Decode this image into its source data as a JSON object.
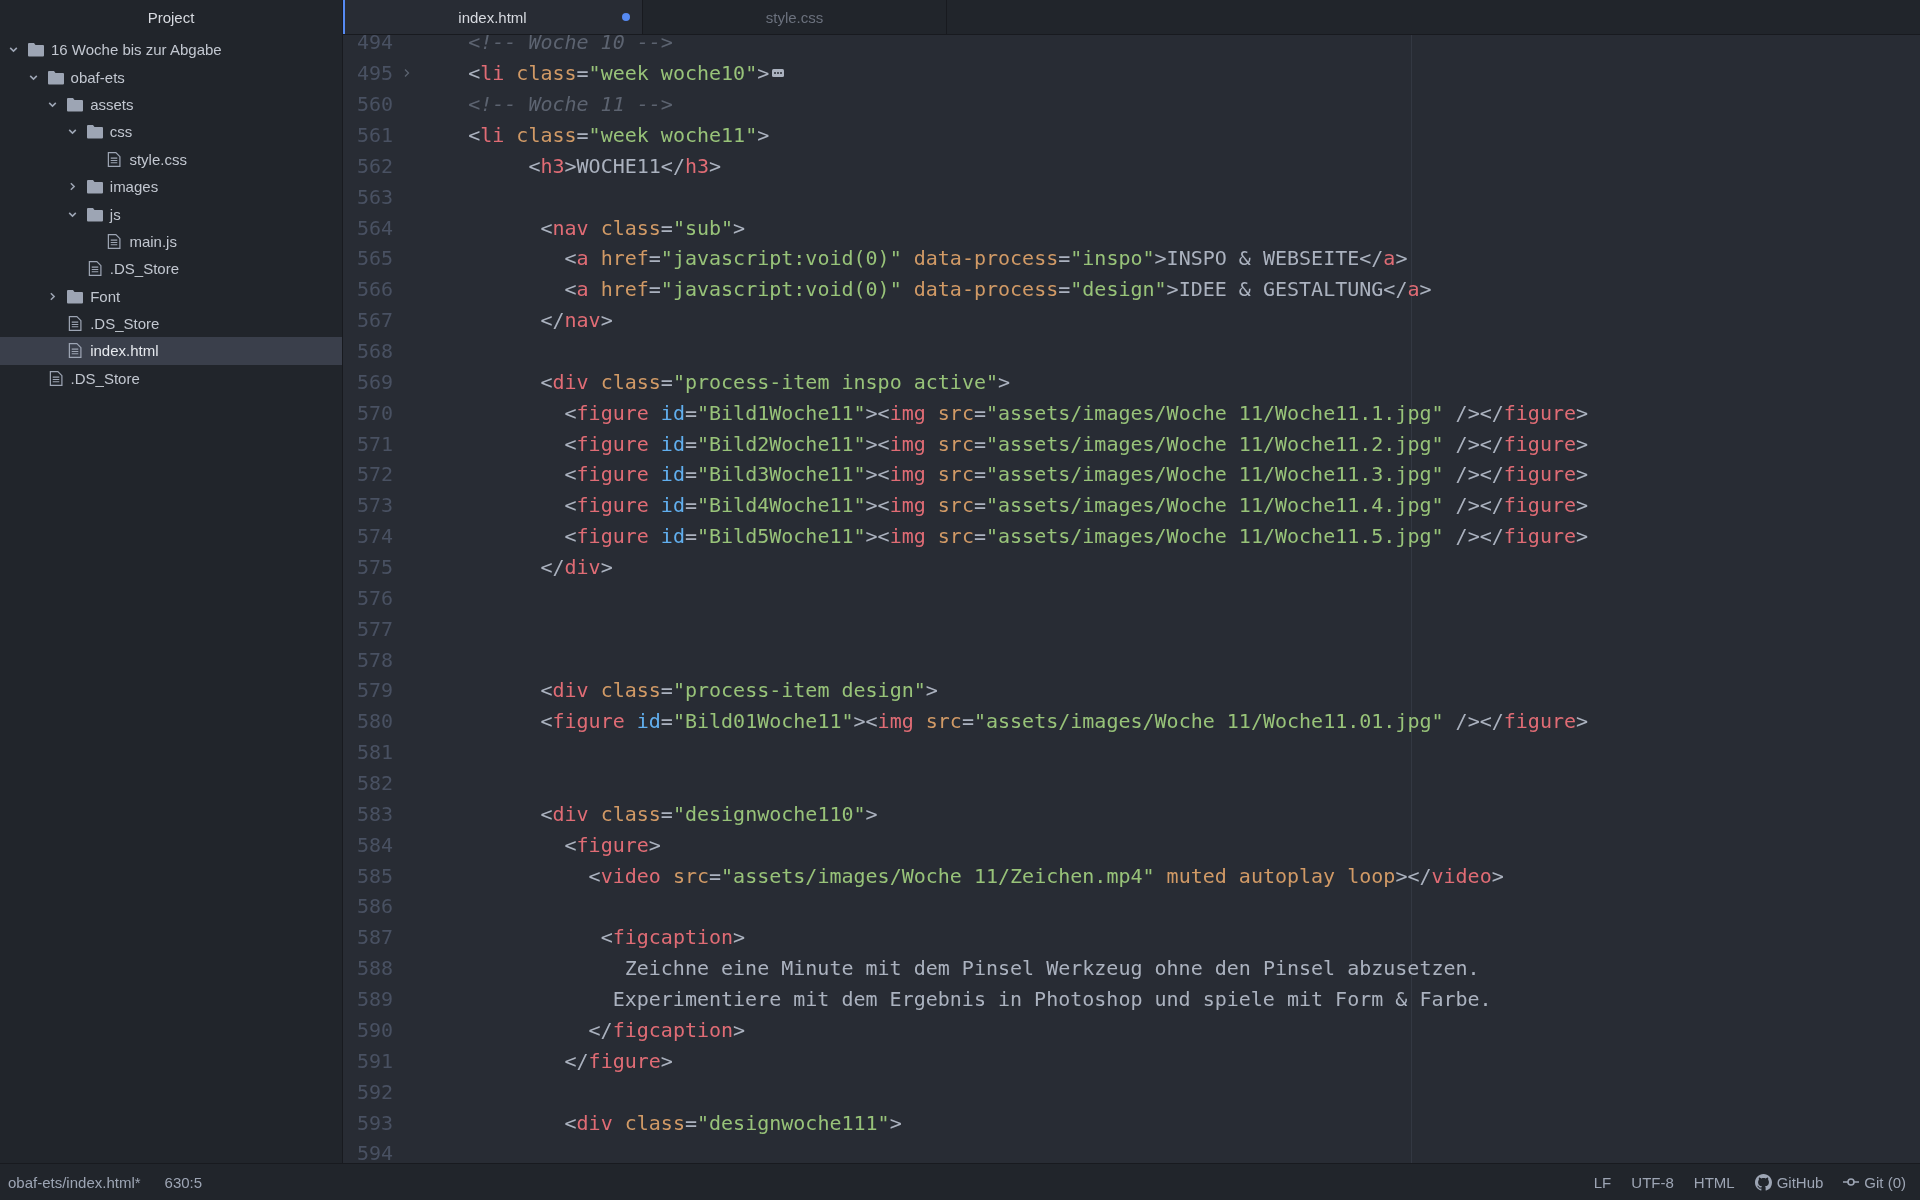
{
  "sidebar": {
    "title": "Project",
    "tree": [
      {
        "kind": "folder",
        "name": "16 Woche bis zur Abgabe",
        "expanded": true,
        "selected": false,
        "children": [
          {
            "kind": "folder",
            "name": "obaf-ets",
            "expanded": true,
            "selected": false,
            "children": [
              {
                "kind": "folder",
                "name": "assets",
                "expanded": true,
                "selected": false,
                "children": [
                  {
                    "kind": "folder",
                    "name": "css",
                    "expanded": true,
                    "selected": false,
                    "children": [
                      {
                        "kind": "file",
                        "name": "style.css",
                        "selected": false
                      }
                    ]
                  },
                  {
                    "kind": "folder",
                    "name": "images",
                    "expanded": false,
                    "selected": false
                  },
                  {
                    "kind": "folder",
                    "name": "js",
                    "expanded": true,
                    "selected": false,
                    "children": [
                      {
                        "kind": "file",
                        "name": "main.js",
                        "selected": false
                      }
                    ]
                  },
                  {
                    "kind": "file",
                    "name": ".DS_Store",
                    "selected": false
                  }
                ]
              },
              {
                "kind": "folder",
                "name": "Font",
                "expanded": false,
                "selected": false
              },
              {
                "kind": "file",
                "name": ".DS_Store",
                "selected": false
              },
              {
                "kind": "file",
                "name": "index.html",
                "selected": true
              }
            ]
          },
          {
            "kind": "file",
            "name": ".DS_Store",
            "selected": false
          }
        ]
      }
    ]
  },
  "tabs": [
    {
      "label": "index.html",
      "selected": true,
      "modified": true
    },
    {
      "label": "style.css",
      "selected": false,
      "modified": false
    }
  ],
  "editor": {
    "lines": [
      {
        "no": "494",
        "folded": false,
        "code": [
          {
            "kind": "com",
            "text": "    <!-- Woche 10 -->"
          }
        ]
      },
      {
        "no": "495",
        "folded": true,
        "code": [
          {
            "kind": "p",
            "text": "    <"
          },
          {
            "kind": "tag",
            "text": "li"
          },
          {
            "kind": "attr",
            "text": " class"
          },
          {
            "kind": "p",
            "text": "="
          },
          {
            "kind": "str",
            "text": "\"week woche10\""
          },
          {
            "kind": "p",
            "text": ">"
          }
        ]
      },
      {
        "no": "560",
        "folded": false,
        "code": [
          {
            "kind": "com",
            "text": "    <!-- Woche 11 -->"
          }
        ]
      },
      {
        "no": "561",
        "folded": false,
        "code": [
          {
            "kind": "p",
            "text": "    <"
          },
          {
            "kind": "tag",
            "text": "li"
          },
          {
            "kind": "attr",
            "text": " class"
          },
          {
            "kind": "p",
            "text": "="
          },
          {
            "kind": "str",
            "text": "\"week woche11\""
          },
          {
            "kind": "p",
            "text": ">"
          }
        ]
      },
      {
        "no": "562",
        "folded": false,
        "code": [
          {
            "kind": "p",
            "text": "         <"
          },
          {
            "kind": "tag",
            "text": "h3"
          },
          {
            "kind": "p",
            "text": ">WOCHE11</"
          },
          {
            "kind": "tag",
            "text": "h3"
          },
          {
            "kind": "p",
            "text": ">"
          }
        ]
      },
      {
        "no": "563",
        "folded": false
      },
      {
        "no": "564",
        "folded": false,
        "code": [
          {
            "kind": "p",
            "text": "          <"
          },
          {
            "kind": "tag",
            "text": "nav"
          },
          {
            "kind": "attr",
            "text": " class"
          },
          {
            "kind": "p",
            "text": "="
          },
          {
            "kind": "str",
            "text": "\"sub\""
          },
          {
            "kind": "p",
            "text": ">"
          }
        ]
      },
      {
        "no": "565",
        "folded": false,
        "code": [
          {
            "kind": "p",
            "text": "            <"
          },
          {
            "kind": "tag",
            "text": "a"
          },
          {
            "kind": "attr",
            "text": " href"
          },
          {
            "kind": "p",
            "text": "="
          },
          {
            "kind": "str",
            "text": "\"javascript:void(0)\""
          },
          {
            "kind": "attr",
            "text": " data-process"
          },
          {
            "kind": "p",
            "text": "="
          },
          {
            "kind": "str",
            "text": "\"inspo\""
          },
          {
            "kind": "p",
            "text": ">INSPO & WEBSEITE</"
          },
          {
            "kind": "tag",
            "text": "a"
          },
          {
            "kind": "p",
            "text": ">"
          }
        ]
      },
      {
        "no": "566",
        "folded": false,
        "code": [
          {
            "kind": "p",
            "text": "            <"
          },
          {
            "kind": "tag",
            "text": "a"
          },
          {
            "kind": "attr",
            "text": " href"
          },
          {
            "kind": "p",
            "text": "="
          },
          {
            "kind": "str",
            "text": "\"javascript:void(0)\""
          },
          {
            "kind": "attr",
            "text": " data-process"
          },
          {
            "kind": "p",
            "text": "="
          },
          {
            "kind": "str",
            "text": "\"design\""
          },
          {
            "kind": "p",
            "text": ">IDEE & GESTALTUNG</"
          },
          {
            "kind": "tag",
            "text": "a"
          },
          {
            "kind": "p",
            "text": ">"
          }
        ]
      },
      {
        "no": "567",
        "folded": false,
        "code": [
          {
            "kind": "p",
            "text": "          </"
          },
          {
            "kind": "tag",
            "text": "nav"
          },
          {
            "kind": "p",
            "text": ">"
          }
        ]
      },
      {
        "no": "568",
        "folded": false
      },
      {
        "no": "569",
        "folded": false,
        "code": [
          {
            "kind": "p",
            "text": "          <"
          },
          {
            "kind": "tag",
            "text": "div"
          },
          {
            "kind": "attr",
            "text": " class"
          },
          {
            "kind": "p",
            "text": "="
          },
          {
            "kind": "str",
            "text": "\"process-item inspo active\""
          },
          {
            "kind": "p",
            "text": ">"
          }
        ]
      },
      {
        "no": "570",
        "folded": false,
        "code": [
          {
            "kind": "p",
            "text": "            <"
          },
          {
            "kind": "tag",
            "text": "figure"
          },
          {
            "kind": "id",
            "text": " id"
          },
          {
            "kind": "p",
            "text": "="
          },
          {
            "kind": "str",
            "text": "\"Bild1Woche11\""
          },
          {
            "kind": "p",
            "text": "><"
          },
          {
            "kind": "tag",
            "text": "img"
          },
          {
            "kind": "attr",
            "text": " src"
          },
          {
            "kind": "p",
            "text": "="
          },
          {
            "kind": "str",
            "text": "\"assets/images/Woche 11/Woche11.1.jpg\""
          },
          {
            "kind": "p",
            "text": " /></"
          },
          {
            "kind": "tag",
            "text": "figure"
          },
          {
            "kind": "p",
            "text": ">"
          }
        ]
      },
      {
        "no": "571",
        "folded": false,
        "code": [
          {
            "kind": "p",
            "text": "            <"
          },
          {
            "kind": "tag",
            "text": "figure"
          },
          {
            "kind": "id",
            "text": " id"
          },
          {
            "kind": "p",
            "text": "="
          },
          {
            "kind": "str",
            "text": "\"Bild2Woche11\""
          },
          {
            "kind": "p",
            "text": "><"
          },
          {
            "kind": "tag",
            "text": "img"
          },
          {
            "kind": "attr",
            "text": " src"
          },
          {
            "kind": "p",
            "text": "="
          },
          {
            "kind": "str",
            "text": "\"assets/images/Woche 11/Woche11.2.jpg\""
          },
          {
            "kind": "p",
            "text": " /></"
          },
          {
            "kind": "tag",
            "text": "figure"
          },
          {
            "kind": "p",
            "text": ">"
          }
        ]
      },
      {
        "no": "572",
        "folded": false,
        "code": [
          {
            "kind": "p",
            "text": "            <"
          },
          {
            "kind": "tag",
            "text": "figure"
          },
          {
            "kind": "id",
            "text": " id"
          },
          {
            "kind": "p",
            "text": "="
          },
          {
            "kind": "str",
            "text": "\"Bild3Woche11\""
          },
          {
            "kind": "p",
            "text": "><"
          },
          {
            "kind": "tag",
            "text": "img"
          },
          {
            "kind": "attr",
            "text": " src"
          },
          {
            "kind": "p",
            "text": "="
          },
          {
            "kind": "str",
            "text": "\"assets/images/Woche 11/Woche11.3.jpg\""
          },
          {
            "kind": "p",
            "text": " /></"
          },
          {
            "kind": "tag",
            "text": "figure"
          },
          {
            "kind": "p",
            "text": ">"
          }
        ]
      },
      {
        "no": "573",
        "folded": false,
        "code": [
          {
            "kind": "p",
            "text": "            <"
          },
          {
            "kind": "tag",
            "text": "figure"
          },
          {
            "kind": "id",
            "text": " id"
          },
          {
            "kind": "p",
            "text": "="
          },
          {
            "kind": "str",
            "text": "\"Bild4Woche11\""
          },
          {
            "kind": "p",
            "text": "><"
          },
          {
            "kind": "tag",
            "text": "img"
          },
          {
            "kind": "attr",
            "text": " src"
          },
          {
            "kind": "p",
            "text": "="
          },
          {
            "kind": "str",
            "text": "\"assets/images/Woche 11/Woche11.4.jpg\""
          },
          {
            "kind": "p",
            "text": " /></"
          },
          {
            "kind": "tag",
            "text": "figure"
          },
          {
            "kind": "p",
            "text": ">"
          }
        ]
      },
      {
        "no": "574",
        "folded": false,
        "code": [
          {
            "kind": "p",
            "text": "            <"
          },
          {
            "kind": "tag",
            "text": "figure"
          },
          {
            "kind": "id",
            "text": " id"
          },
          {
            "kind": "p",
            "text": "="
          },
          {
            "kind": "str",
            "text": "\"Bild5Woche11\""
          },
          {
            "kind": "p",
            "text": "><"
          },
          {
            "kind": "tag",
            "text": "img"
          },
          {
            "kind": "attr",
            "text": " src"
          },
          {
            "kind": "p",
            "text": "="
          },
          {
            "kind": "str",
            "text": "\"assets/images/Woche 11/Woche11.5.jpg\""
          },
          {
            "kind": "p",
            "text": " /></"
          },
          {
            "kind": "tag",
            "text": "figure"
          },
          {
            "kind": "p",
            "text": ">"
          }
        ]
      },
      {
        "no": "575",
        "folded": false,
        "code": [
          {
            "kind": "p",
            "text": "          </"
          },
          {
            "kind": "tag",
            "text": "div"
          },
          {
            "kind": "p",
            "text": ">"
          }
        ]
      },
      {
        "no": "576",
        "folded": false
      },
      {
        "no": "577",
        "folded": false
      },
      {
        "no": "578",
        "folded": false
      },
      {
        "no": "579",
        "folded": false,
        "code": [
          {
            "kind": "p",
            "text": "          <"
          },
          {
            "kind": "tag",
            "text": "div"
          },
          {
            "kind": "attr",
            "text": " class"
          },
          {
            "kind": "p",
            "text": "="
          },
          {
            "kind": "str",
            "text": "\"process-item design\""
          },
          {
            "kind": "p",
            "text": ">"
          }
        ]
      },
      {
        "no": "580",
        "folded": false,
        "code": [
          {
            "kind": "p",
            "text": "          <"
          },
          {
            "kind": "tag",
            "text": "figure"
          },
          {
            "kind": "id",
            "text": " id"
          },
          {
            "kind": "p",
            "text": "="
          },
          {
            "kind": "str",
            "text": "\"Bild01Woche11\""
          },
          {
            "kind": "p",
            "text": "><"
          },
          {
            "kind": "tag",
            "text": "img"
          },
          {
            "kind": "attr",
            "text": " src"
          },
          {
            "kind": "p",
            "text": "="
          },
          {
            "kind": "str",
            "text": "\"assets/images/Woche 11/Woche11.01.jpg\""
          },
          {
            "kind": "p",
            "text": " /></"
          },
          {
            "kind": "tag",
            "text": "figure"
          },
          {
            "kind": "p",
            "text": ">"
          }
        ]
      },
      {
        "no": "581",
        "folded": false
      },
      {
        "no": "582",
        "folded": false
      },
      {
        "no": "583",
        "folded": false,
        "code": [
          {
            "kind": "p",
            "text": "          <"
          },
          {
            "kind": "tag",
            "text": "div"
          },
          {
            "kind": "attr",
            "text": " class"
          },
          {
            "kind": "p",
            "text": "="
          },
          {
            "kind": "str",
            "text": "\"designwoche110\""
          },
          {
            "kind": "p",
            "text": ">"
          }
        ]
      },
      {
        "no": "584",
        "folded": false,
        "code": [
          {
            "kind": "p",
            "text": "            <"
          },
          {
            "kind": "tag",
            "text": "figure"
          },
          {
            "kind": "p",
            "text": ">"
          }
        ]
      },
      {
        "no": "585",
        "folded": false,
        "code": [
          {
            "kind": "p",
            "text": "              <"
          },
          {
            "kind": "tag",
            "text": "video"
          },
          {
            "kind": "attr",
            "text": " src"
          },
          {
            "kind": "p",
            "text": "="
          },
          {
            "kind": "str",
            "text": "\"assets/images/Woche 11/Zeichen.mp4\""
          },
          {
            "kind": "attr",
            "text": " muted autoplay loop"
          },
          {
            "kind": "p",
            "text": "></"
          },
          {
            "kind": "tag",
            "text": "video"
          },
          {
            "kind": "p",
            "text": ">"
          }
        ]
      },
      {
        "no": "586",
        "folded": false
      },
      {
        "no": "587",
        "folded": false,
        "code": [
          {
            "kind": "p",
            "text": "               <"
          },
          {
            "kind": "tag",
            "text": "figcaption"
          },
          {
            "kind": "p",
            "text": ">"
          }
        ]
      },
      {
        "no": "588",
        "folded": false,
        "code": [
          {
            "kind": "txt",
            "text": "                 Zeichne eine Minute mit dem Pinsel Werkzeug ohne den Pinsel abzusetzen."
          }
        ]
      },
      {
        "no": "589",
        "folded": false,
        "code": [
          {
            "kind": "txt",
            "text": "                Experimentiere mit dem Ergebnis in Photoshop und spiele mit Form & Farbe."
          }
        ]
      },
      {
        "no": "590",
        "folded": false,
        "code": [
          {
            "kind": "p",
            "text": "              </"
          },
          {
            "kind": "tag",
            "text": "figcaption"
          },
          {
            "kind": "p",
            "text": ">"
          }
        ]
      },
      {
        "no": "591",
        "folded": false,
        "code": [
          {
            "kind": "p",
            "text": "            </"
          },
          {
            "kind": "tag",
            "text": "figure"
          },
          {
            "kind": "p",
            "text": ">"
          }
        ]
      },
      {
        "no": "592",
        "folded": false
      },
      {
        "no": "593",
        "folded": false,
        "code": [
          {
            "kind": "p",
            "text": "            <"
          },
          {
            "kind": "tag",
            "text": "div"
          },
          {
            "kind": "attr",
            "text": " class"
          },
          {
            "kind": "p",
            "text": "="
          },
          {
            "kind": "str",
            "text": "\"designwoche111\""
          },
          {
            "kind": "p",
            "text": ">"
          }
        ]
      },
      {
        "no": "594",
        "folded": false
      }
    ]
  },
  "status_bar": {
    "left": [
      "obaf-ets/index.html*",
      "630:5"
    ],
    "right": [
      {
        "kind": "plain",
        "text": "LF"
      },
      {
        "kind": "plain",
        "text": "UTF-8"
      },
      {
        "kind": "plain",
        "text": "HTML"
      },
      {
        "kind": "github",
        "text": "GitHub"
      },
      {
        "kind": "git",
        "text": "Git (0)"
      }
    ]
  }
}
